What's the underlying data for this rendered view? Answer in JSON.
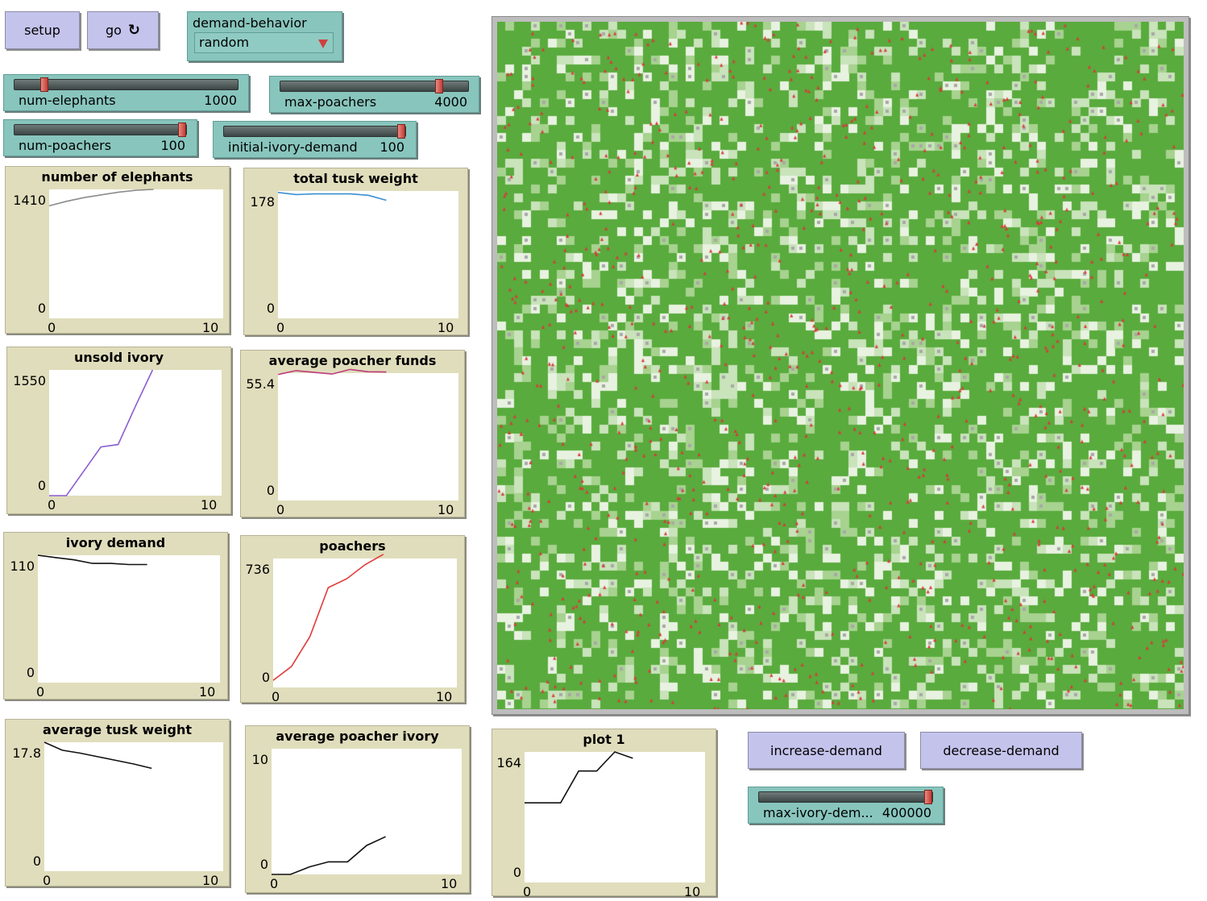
{
  "buttons": {
    "setup": "setup",
    "go": "go",
    "go_forever_icon": "forever-icon",
    "increase_demand": "increase-demand",
    "decrease_demand": "decrease-demand"
  },
  "chooser": {
    "label": "demand-behavior",
    "value": "random"
  },
  "sliders": {
    "num_elephants": {
      "label": "num-elephants",
      "value": "1000",
      "fraction": 0.12
    },
    "max_poachers": {
      "label": "max-poachers",
      "value": "4000",
      "fraction": 0.86
    },
    "num_poachers": {
      "label": "num-poachers",
      "value": "100",
      "fraction": 1.0
    },
    "initial_ivory_demand": {
      "label": "initial-ivory-demand",
      "value": "100",
      "fraction": 1.0
    },
    "max_ivory_demand": {
      "label": "max-ivory-dem...",
      "value": "400000",
      "fraction": 1.0
    }
  },
  "colors": {
    "world_green": "#59ab3d",
    "patch_light": "#e8f2e0",
    "turtle_red": "#d83a3a",
    "elephant_gray": "#a8a8a8"
  },
  "plots": {
    "number_of_elephants": {
      "title": "number of elephants",
      "ymax": "1410",
      "ymin": "0",
      "xmin": "0",
      "xmax": "10"
    },
    "total_tusk_weight": {
      "title": "total tusk weight",
      "ymax": "178",
      "ymin": "0",
      "xmin": "0",
      "xmax": "10"
    },
    "unsold_ivory": {
      "title": "unsold ivory",
      "ymax": "1550",
      "ymin": "0",
      "xmin": "0",
      "xmax": "10"
    },
    "average_poacher_funds": {
      "title": "average poacher funds",
      "ymax": "55.4",
      "ymin": "0",
      "xmin": "0",
      "xmax": "10"
    },
    "ivory_demand": {
      "title": "ivory demand",
      "ymax": "110",
      "ymin": "0",
      "xmin": "0",
      "xmax": "10"
    },
    "poachers": {
      "title": "poachers",
      "ymax": "736",
      "ymin": "0",
      "xmin": "0",
      "xmax": "10"
    },
    "average_tusk_weight": {
      "title": "average tusk weight",
      "ymax": "17.8",
      "ymin": "0",
      "xmin": "0",
      "xmax": "10"
    },
    "average_poacher_ivory": {
      "title": "average poacher ivory",
      "ymax": "10",
      "ymin": "0",
      "xmin": "0",
      "xmax": "10"
    },
    "plot_1": {
      "title": "plot 1",
      "ymax": "164",
      "ymin": "0",
      "xmin": "0",
      "xmax": "10"
    }
  },
  "chart_data": [
    {
      "type": "line",
      "title": "number of elephants",
      "ylim": [
        0,
        1410
      ],
      "xlim": [
        0,
        10
      ],
      "series": [
        {
          "color": "#8c8c8c",
          "x": [
            0,
            1,
            2,
            3,
            4,
            5,
            6
          ],
          "y": [
            1230,
            1280,
            1320,
            1350,
            1380,
            1400,
            1410
          ]
        }
      ]
    },
    {
      "type": "line",
      "title": "total tusk weight",
      "ylim": [
        0,
        178
      ],
      "xlim": [
        0,
        10
      ],
      "series": [
        {
          "color": "#3a8fd0",
          "x": [
            0,
            1,
            2,
            3,
            4,
            5,
            6
          ],
          "y": [
            176,
            173,
            174,
            174,
            174,
            172,
            165
          ]
        }
      ]
    },
    {
      "type": "line",
      "title": "unsold ivory",
      "ylim": [
        0,
        1550
      ],
      "xlim": [
        0,
        10
      ],
      "series": [
        {
          "color": "#8a5ed0",
          "x": [
            0,
            1,
            2,
            3,
            4,
            5,
            6
          ],
          "y": [
            0,
            0,
            300,
            600,
            630,
            1100,
            1550
          ]
        }
      ]
    },
    {
      "type": "line",
      "title": "average poacher funds",
      "ylim": [
        0,
        55.4
      ],
      "xlim": [
        0,
        10
      ],
      "series": [
        {
          "color": "#c0397a",
          "x": [
            0,
            1,
            2,
            3,
            4,
            5,
            6
          ],
          "y": [
            54.8,
            56.5,
            55.7,
            55.0,
            57.0,
            56.0,
            55.9
          ]
        }
      ]
    },
    {
      "type": "line",
      "title": "ivory demand",
      "ylim": [
        0,
        110
      ],
      "xlim": [
        0,
        10
      ],
      "series": [
        {
          "color": "#111111",
          "x": [
            0,
            1,
            2,
            3,
            4,
            5,
            6
          ],
          "y": [
            110,
            108,
            106,
            103,
            103,
            102,
            102
          ]
        }
      ]
    },
    {
      "type": "line",
      "title": "poachers",
      "ylim": [
        0,
        736
      ],
      "xlim": [
        0,
        10
      ],
      "series": [
        {
          "color": "#e03b3b",
          "x": [
            0,
            1,
            2,
            3,
            4,
            5,
            6
          ],
          "y": [
            40,
            120,
            290,
            570,
            620,
            700,
            760
          ]
        }
      ]
    },
    {
      "type": "line",
      "title": "average tusk weight",
      "ylim": [
        0,
        17.8
      ],
      "xlim": [
        0,
        10
      ],
      "series": [
        {
          "color": "#111111",
          "x": [
            0,
            1,
            2,
            3,
            4,
            5,
            6
          ],
          "y": [
            17.8,
            16.7,
            16.3,
            15.8,
            15.3,
            14.8,
            14.2
          ]
        }
      ]
    },
    {
      "type": "line",
      "title": "average poacher ivory",
      "ylim": [
        0,
        10
      ],
      "xlim": [
        0,
        10
      ],
      "series": [
        {
          "color": "#111111",
          "x": [
            0,
            1,
            2,
            3,
            4,
            5,
            6
          ],
          "y": [
            0,
            0,
            0.6,
            1.0,
            1.0,
            2.3,
            3.0
          ]
        }
      ]
    },
    {
      "type": "line",
      "title": "plot 1",
      "ylim": [
        0,
        164
      ],
      "xlim": [
        0,
        10
      ],
      "series": [
        {
          "color": "#111111",
          "x": [
            0,
            1,
            2,
            3,
            4,
            5,
            6
          ],
          "y": [
            100,
            100,
            100,
            140,
            140,
            164,
            156
          ]
        }
      ]
    }
  ]
}
